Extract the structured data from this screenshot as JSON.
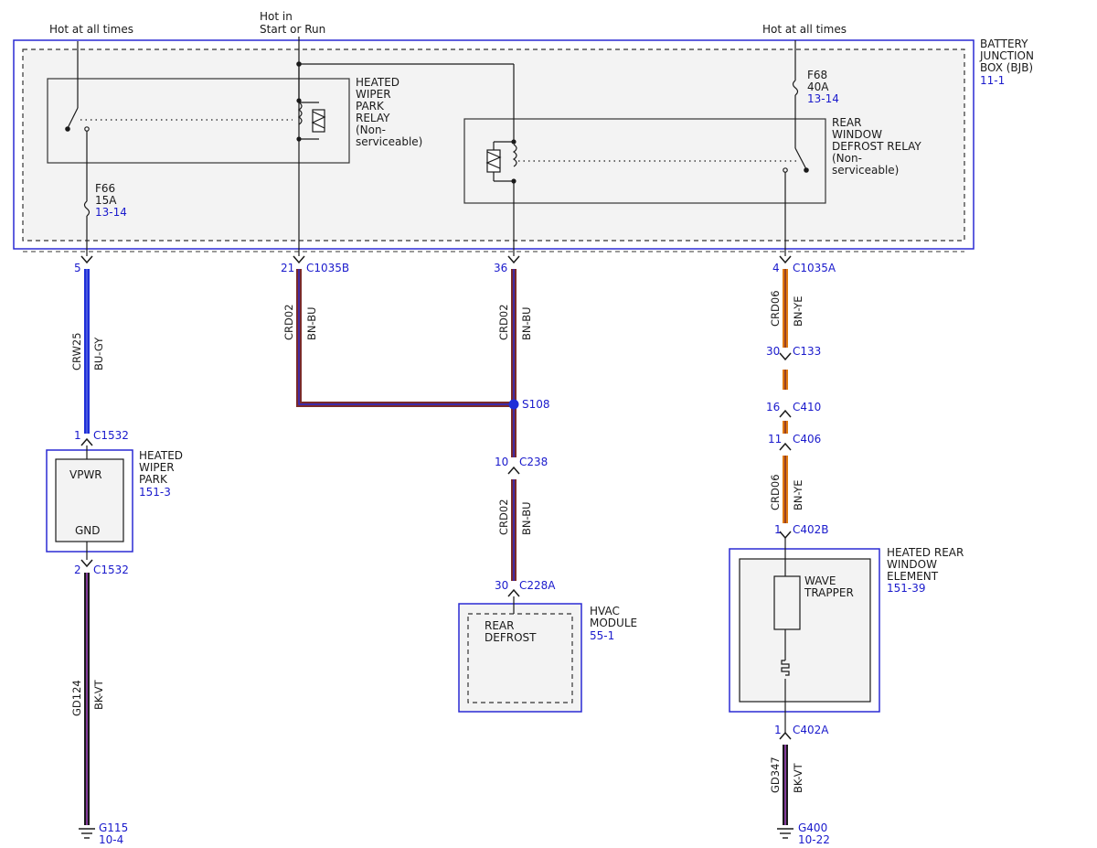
{
  "power": {
    "hot_left": "Hot at all times",
    "hot_mid_1": "Hot in",
    "hot_mid_2": "Start or Run",
    "hot_right": "Hot at all times"
  },
  "bjb": {
    "l1": "BATTERY",
    "l2": "JUNCTION",
    "l3": "BOX (BJB)",
    "ref": "11-1"
  },
  "wiper_relay": {
    "l1": "HEATED",
    "l2": "WIPER",
    "l3": "PARK",
    "l4": "RELAY",
    "l5": "(Non-",
    "l6": "serviceable)"
  },
  "defrost_relay": {
    "l1": "REAR",
    "l2": "WINDOW",
    "l3": "DEFROST RELAY",
    "l4": "(Non-",
    "l5": "serviceable)"
  },
  "fuses": {
    "f68": {
      "name": "F68",
      "rating": "40A",
      "ref": "13-14"
    },
    "f66": {
      "name": "F66",
      "rating": "15A",
      "ref": "13-14"
    }
  },
  "pins": {
    "p5": "5",
    "p21": "21",
    "p36": "36",
    "p4": "4",
    "p30a": "30",
    "p16": "16",
    "p11": "11",
    "p1a": "1",
    "p1b": "1",
    "p2": "2",
    "p10": "10",
    "p30b": "30",
    "p1c": "1"
  },
  "connectors": {
    "c1035b": "C1035B",
    "c1035a": "C1035A",
    "c133": "C133",
    "c410": "C410",
    "c406": "C406",
    "c402b": "C402B",
    "c402a": "C402A",
    "c1532_top": "C1532",
    "c1532_bot": "C1532",
    "c238": "C238",
    "c228a": "C228A"
  },
  "splice": {
    "name": "S108"
  },
  "wires": {
    "w_crw25": {
      "circuit": "CRW25",
      "color": "BU-GY"
    },
    "w_crd02_a": {
      "circuit": "CRD02",
      "color": "BN-BU"
    },
    "w_crd02_b": {
      "circuit": "CRD02",
      "color": "BN-BU"
    },
    "w_crd02_c": {
      "circuit": "CRD02",
      "color": "BN-BU"
    },
    "w_crd06_a": {
      "circuit": "CRD06",
      "color": "BN-YE"
    },
    "w_crd06_b": {
      "circuit": "CRD06",
      "color": "BN-YE"
    },
    "w_gd124": {
      "circuit": "GD124",
      "color": "BK-VT"
    },
    "w_gd347": {
      "circuit": "GD347",
      "color": "BK-VT"
    }
  },
  "wiper_park": {
    "l1": "HEATED",
    "l2": "WIPER",
    "l3": "PARK",
    "ref": "151-3",
    "vpwr": "VPWR",
    "gnd": "GND"
  },
  "hvac": {
    "l1": "HVAC",
    "l2": "MODULE",
    "ref": "55-1",
    "inner1": "REAR",
    "inner2": "DEFROST"
  },
  "rear_element": {
    "l1": "HEATED REAR",
    "l2": "WINDOW",
    "l3": "ELEMENT",
    "ref": "151-39",
    "trap1": "WAVE",
    "trap2": "TRAPPER"
  },
  "grounds": {
    "g115": {
      "name": "G115",
      "ref": "10-4"
    },
    "g400": {
      "name": "G400",
      "ref": "10-22"
    }
  },
  "colors": {
    "frame_blue": "#2a2ad4",
    "text_blue": "#1a1acc",
    "box_fill": "#f3f3f3",
    "wire_blue": "#1f2fd8",
    "wire_brown": "#7a2a2a",
    "wire_orange": "#e07a10",
    "wire_black": "#1a1a1a",
    "wire_violet": "#7a3aa0"
  }
}
